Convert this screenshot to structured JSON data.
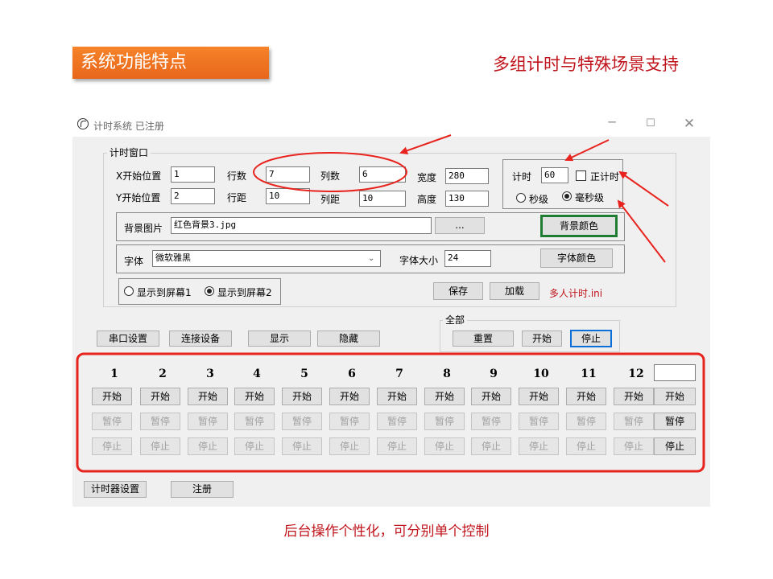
{
  "slide": {
    "banner": "系统功能特点",
    "subtitle": "多组计时与特殊场景支持",
    "caption": "后台操作个性化，可分别单个控制"
  },
  "window": {
    "title": "计时系统 已注册",
    "minimize": "─",
    "maximize": "☐",
    "close": "✕"
  },
  "timer_window": {
    "legend": "计时窗口",
    "x_start_label": "X开始位置",
    "x_start_value": "1",
    "y_start_label": "Y开始位置",
    "y_start_value": "2",
    "rows_label": "行数",
    "rows_value": "7",
    "row_gap_label": "行距",
    "row_gap_value": "10",
    "cols_label": "列数",
    "cols_value": "6",
    "col_gap_label": "列距",
    "col_gap_value": "10",
    "width_label": "宽度",
    "width_value": "280",
    "height_label": "高度",
    "height_value": "130",
    "timing_label": "计时",
    "timing_value": "60",
    "count_up_label": "正计时",
    "seconds_label": "秒级",
    "ms_label": "毫秒级",
    "bg_image_label": "背景图片",
    "bg_image_value": "红色背景3.jpg",
    "browse_label": "...",
    "bg_color_label": "背景颜色",
    "font_label": "字体",
    "font_value": "微软雅黑",
    "font_size_label": "字体大小",
    "font_size_value": "24",
    "font_color_label": "字体颜色",
    "screen1_label": "显示到屏幕1",
    "screen2_label": "显示到屏幕2",
    "save_label": "保存",
    "load_label": "加载",
    "ini_file": "多人计时.ini"
  },
  "toolbar": {
    "serial_label": "串口设置",
    "connect_label": "连接设备",
    "show_label": "显示",
    "hide_label": "隐藏"
  },
  "all_group": {
    "legend": "全部",
    "reset_label": "重置",
    "start_label": "开始",
    "stop_label": "停止"
  },
  "timers": {
    "numbers": [
      "1",
      "2",
      "3",
      "4",
      "5",
      "6",
      "7",
      "8",
      "9",
      "10",
      "11",
      "12"
    ],
    "start_label": "开始",
    "pause_label": "暂停",
    "stop_label": "停止",
    "global_value": "",
    "global_start": "开始",
    "global_pause": "暂停",
    "global_stop": "停止"
  },
  "footer": {
    "timer_settings_label": "计时器设置",
    "register_label": "注册"
  },
  "colors": {
    "accent_orange": "#f07a22",
    "annotation_red": "#e8231e",
    "caption_red": "#c0141c",
    "focus_blue": "#0a6fd6",
    "bg_color_border": "#1e7d32"
  }
}
